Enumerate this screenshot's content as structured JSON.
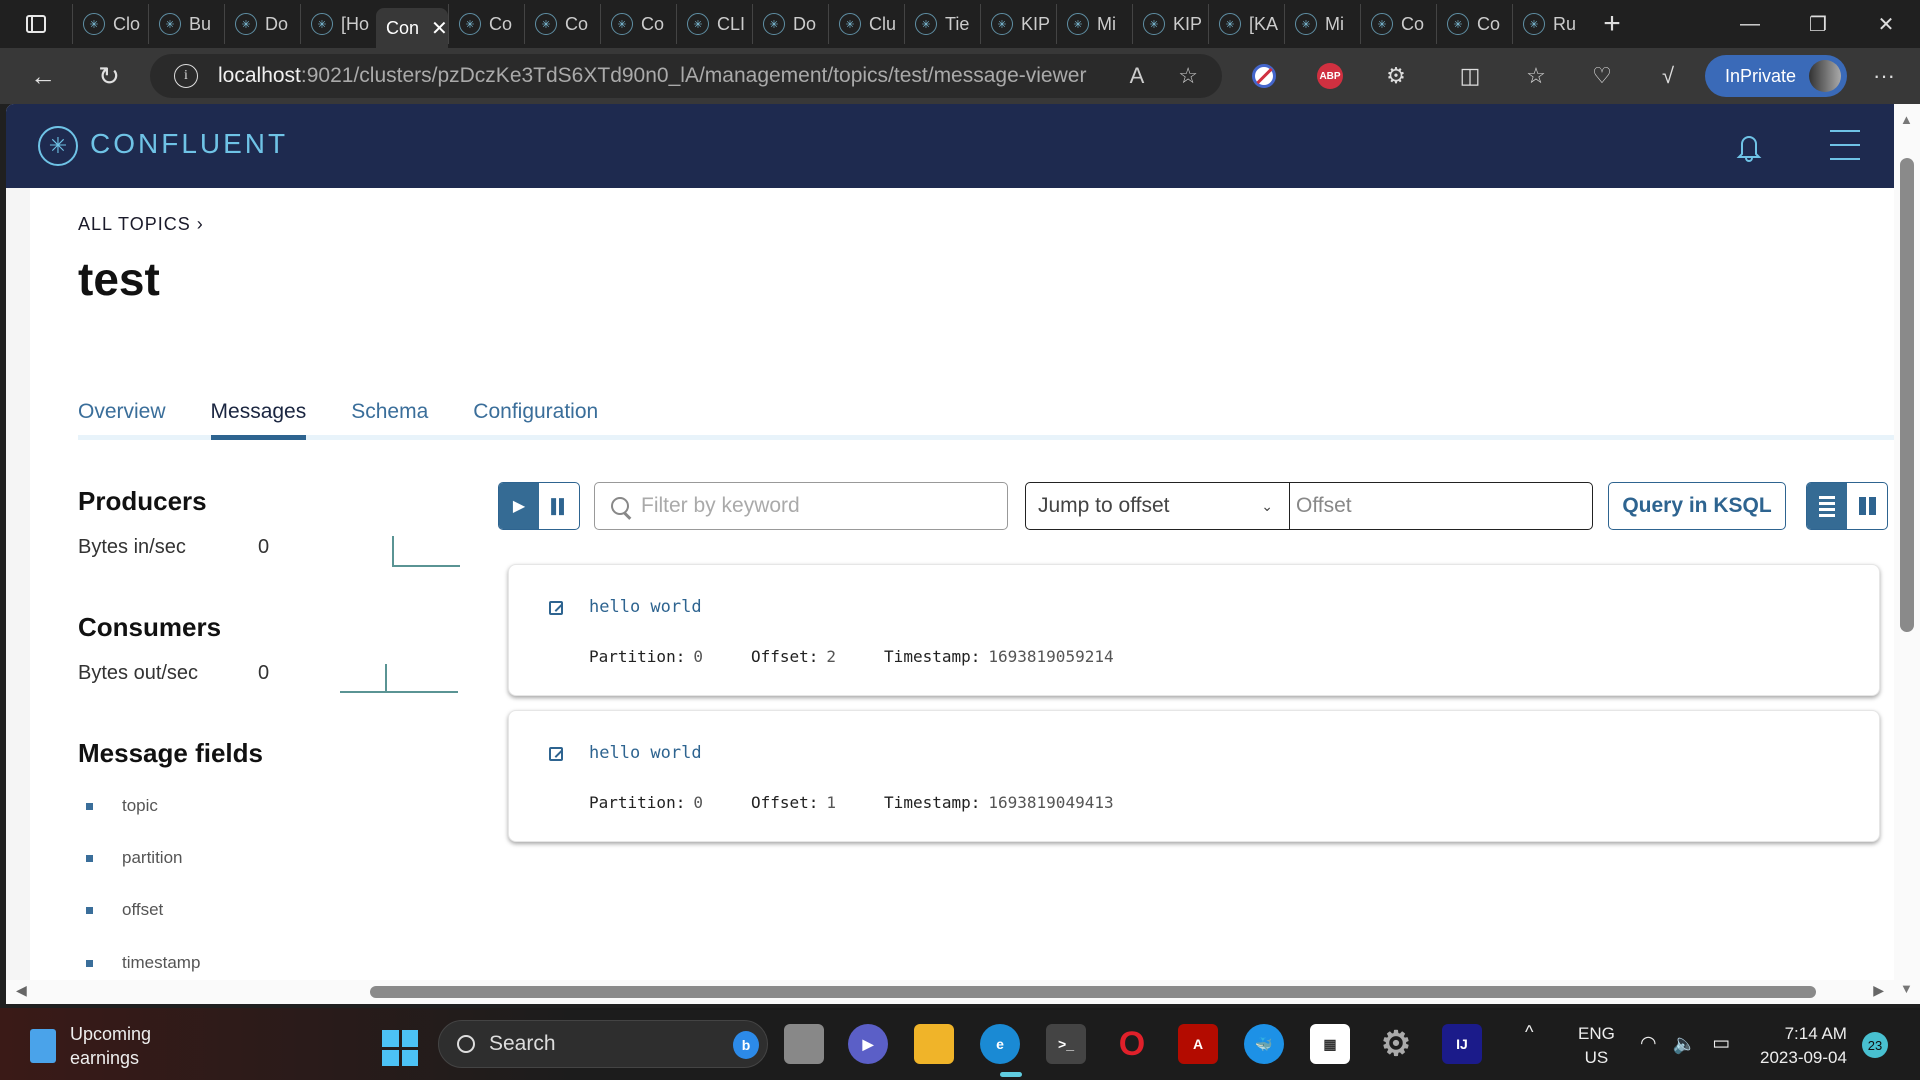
{
  "browser": {
    "tabs": [
      {
        "label": "Clo",
        "icon": "shield-icon"
      },
      {
        "label": "Bu",
        "icon": "server-icon"
      },
      {
        "label": "Do",
        "icon": "confluent-icon"
      },
      {
        "label": "[Ho",
        "icon": "github-icon"
      },
      {
        "label": "Con",
        "icon": "none",
        "active": true
      },
      {
        "label": "Co",
        "icon": "confluent-icon"
      },
      {
        "label": "Co",
        "icon": "confluent-icon"
      },
      {
        "label": "Co",
        "icon": "confluent-icon"
      },
      {
        "label": "CLI",
        "icon": "confluent-icon"
      },
      {
        "label": "Do",
        "icon": "confluent-icon"
      },
      {
        "label": "Clu",
        "icon": "confluent-icon"
      },
      {
        "label": "Tie",
        "icon": "confluent-icon"
      },
      {
        "label": "KIP",
        "icon": "confluence-icon"
      },
      {
        "label": "Mi",
        "icon": "confluent-icon"
      },
      {
        "label": "KIP",
        "icon": "confluence-icon"
      },
      {
        "label": "[KA",
        "icon": "jira-icon"
      },
      {
        "label": "Mi",
        "icon": "confluent-icon"
      },
      {
        "label": "Co",
        "icon": "confluent-icon"
      },
      {
        "label": "Co",
        "icon": "confluent-icon"
      },
      {
        "label": "Ru",
        "icon": "game-icon"
      }
    ],
    "new_tab": "+",
    "url_host": "localhost",
    "url_rest": ":9021/clusters/pzDczKe3TdS6XTd90n0_lA/management/topics/test/message-viewer",
    "inprivate_label": "InPrivate",
    "window_controls": {
      "minimize": "—",
      "restore": "❐",
      "close": "✕"
    }
  },
  "app": {
    "brand": "CONFLUENT",
    "breadcrumb": "ALL TOPICS",
    "topic_title": "test",
    "tabs": [
      {
        "label": "Overview",
        "active": false
      },
      {
        "label": "Messages",
        "active": true
      },
      {
        "label": "Schema",
        "active": false
      },
      {
        "label": "Configuration",
        "active": false
      }
    ],
    "producers": {
      "heading": "Producers",
      "metric_label": "Bytes in/sec",
      "value": "0"
    },
    "consumers": {
      "heading": "Consumers",
      "metric_label": "Bytes out/sec",
      "value": "0"
    },
    "message_fields": {
      "heading": "Message fields",
      "items": [
        "topic",
        "partition",
        "offset",
        "timestamp"
      ]
    },
    "toolbar": {
      "filter_placeholder": "Filter by keyword",
      "jump_select_value": "Jump to offset",
      "offset_placeholder": "Offset",
      "ksql_button": "Query in KSQL"
    },
    "messages": [
      {
        "value": "hello world",
        "partition_label": "Partition:",
        "partition": "0",
        "offset_label": "Offset:",
        "offset": "2",
        "timestamp_label": "Timestamp:",
        "timestamp": "1693819059214"
      },
      {
        "value": "hello world",
        "partition_label": "Partition:",
        "partition": "0",
        "offset_label": "Offset:",
        "offset": "1",
        "timestamp_label": "Timestamp:",
        "timestamp": "1693819049413"
      }
    ]
  },
  "taskbar": {
    "widget_line1": "Upcoming",
    "widget_line2": "earnings",
    "search_label": "Search",
    "lang_line1": "ENG",
    "lang_line2": "US",
    "time": "7:14 AM",
    "date": "2023-09-04",
    "notifications": "23"
  },
  "colors": {
    "header_bg": "#1e2a4f",
    "brand": "#6fc3e6",
    "accent": "#2e6490"
  }
}
